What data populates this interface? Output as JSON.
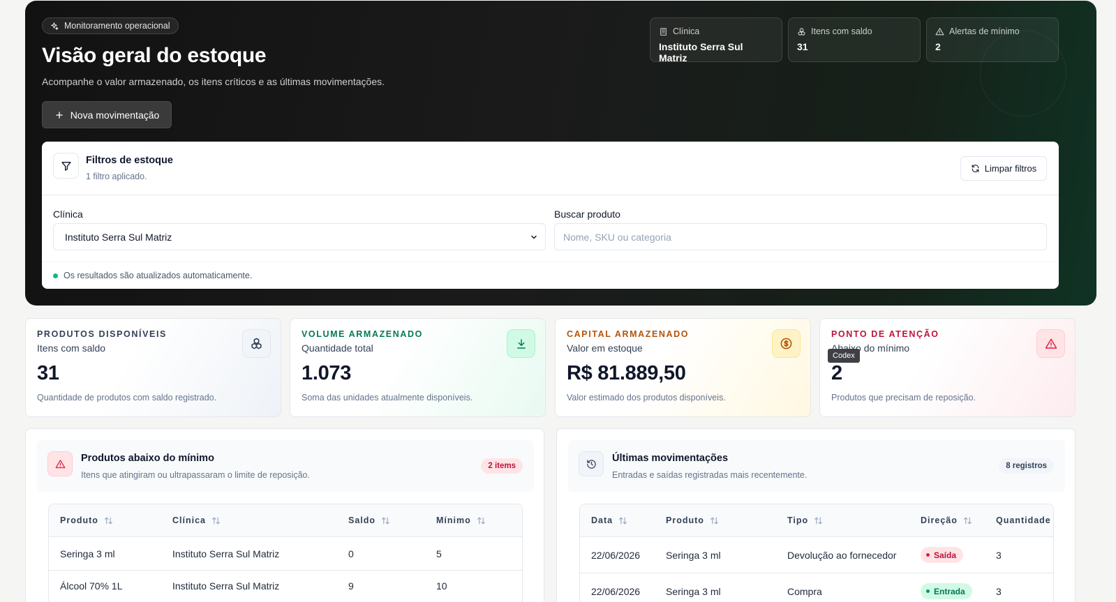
{
  "hero": {
    "chip": "Monitoramento operacional",
    "title": "Visão geral do estoque",
    "subtitle": "Acompanhe o valor armazenado, os itens críticos e as últimas movimentações.",
    "new_button": "Nova movimentação",
    "stats": [
      {
        "label": "Clínica",
        "value": "Instituto Serra Sul Matriz",
        "icon": "building-icon"
      },
      {
        "label": "Itens com saldo",
        "value": "31",
        "icon": "boxes-icon"
      },
      {
        "label": "Alertas de mínimo",
        "value": "2",
        "icon": "warning-icon"
      }
    ]
  },
  "filters": {
    "title": "Filtros de estoque",
    "subtitle": "1 filtro aplicado.",
    "clear_button": "Limpar filtros",
    "clinic_label": "Clínica",
    "clinic_selected": "Instituto Serra Sul Matriz",
    "search_label": "Buscar produto",
    "search_placeholder": "Nome, SKU ou categoria",
    "search_value": "",
    "live_note": "Os resultados são atualizados automaticamente."
  },
  "kpis": [
    {
      "eyebrow": "PRODUTOS DISPONÍVEIS",
      "label": "Itens com saldo",
      "value": "31",
      "desc": "Quantidade de produtos com saldo registrado.",
      "icon": "boxes-icon",
      "accent": "#334155"
    },
    {
      "eyebrow": "VOLUME ARMAZENADO",
      "label": "Quantidade total",
      "value": "1.073",
      "desc": "Soma das unidades atualmente disponíveis.",
      "icon": "download-icon",
      "accent": "#047857"
    },
    {
      "eyebrow": "CAPITAL ARMAZENADO",
      "label": "Valor em estoque",
      "value": "R$ 81.889,50",
      "desc": "Valor estimado dos produtos disponíveis.",
      "icon": "dollar-coin-icon",
      "accent": "#b45309"
    },
    {
      "eyebrow": "PONTO DE ATENÇÃO",
      "label": "Abaixo do mínimo",
      "value": "2",
      "desc": "Produtos que precisam de reposição.",
      "icon": "warning-icon",
      "accent": "#be123c"
    }
  ],
  "tooltip": "Codex",
  "low_stock": {
    "title": "Produtos abaixo do mínimo",
    "subtitle": "Itens que atingiram ou ultrapassaram o limite de reposição.",
    "badge": "2 items",
    "columns": [
      "Produto",
      "Clínica",
      "Saldo",
      "Mínimo"
    ],
    "rows": [
      [
        "Seringa 3 ml",
        "Instituto Serra Sul Matriz",
        "0",
        "5"
      ],
      [
        "Álcool 70% 1L",
        "Instituto Serra Sul Matriz",
        "9",
        "10"
      ]
    ]
  },
  "movements": {
    "title": "Últimas movimentações",
    "subtitle": "Entradas e saídas registradas mais recentemente.",
    "badge": "8 registros",
    "columns": [
      "Data",
      "Produto",
      "Tipo",
      "Direção",
      "Quantidade"
    ],
    "rows": [
      {
        "date": "22/06/2026",
        "product": "Seringa 3 ml",
        "type": "Devolução ao fornecedor",
        "direction": "Saída",
        "qty": "3"
      },
      {
        "date": "22/06/2026",
        "product": "Seringa 3 ml",
        "type": "Compra",
        "direction": "Entrada",
        "qty": "3"
      }
    ]
  },
  "colors": {
    "danger": "#e11d48",
    "success": "#059669",
    "warning": "#d97706"
  }
}
